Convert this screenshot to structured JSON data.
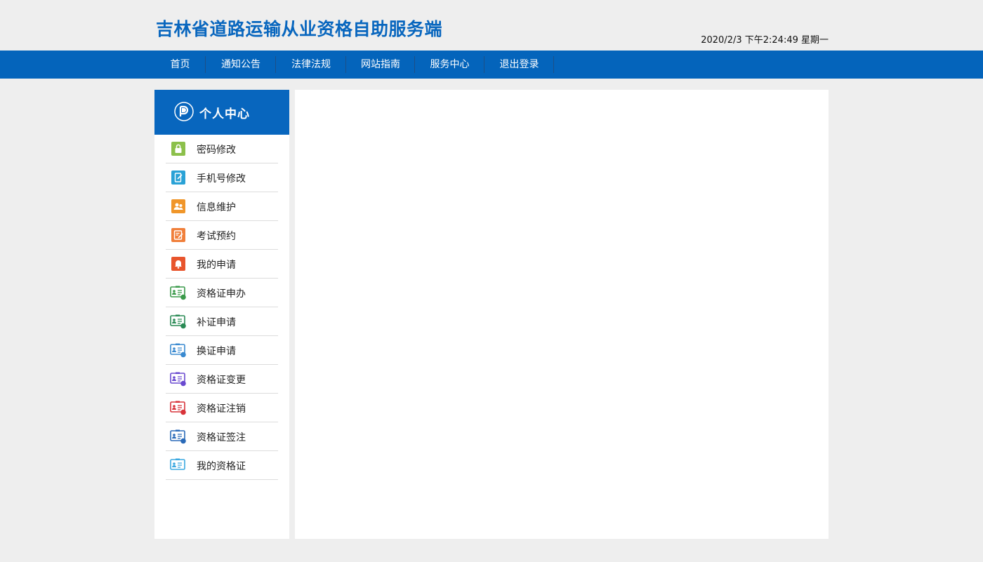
{
  "header": {
    "title": "吉林省道路运输从业资格自助服务端",
    "datetime": "2020/2/3 下午2:24:49 星期一"
  },
  "colors": {
    "brand_blue": "#0464bb",
    "sidebar_header": "#0866be",
    "page_bg": "#eeeeee"
  },
  "nav": {
    "items": [
      {
        "label": "首页"
      },
      {
        "label": "通知公告"
      },
      {
        "label": "法律法规"
      },
      {
        "label": "网站指南"
      },
      {
        "label": "服务中心"
      },
      {
        "label": "退出登录"
      }
    ]
  },
  "sidebar": {
    "title": "个人中心",
    "logo_icon": "p-circle-logo-icon",
    "items": [
      {
        "label": "密码修改",
        "icon": "lock-icon",
        "color": "#8cc04b"
      },
      {
        "label": "手机号修改",
        "icon": "phone-edit-icon",
        "color": "#2aa2d6"
      },
      {
        "label": "信息维护",
        "icon": "user-info-icon",
        "color": "#f0962a"
      },
      {
        "label": "考试预约",
        "icon": "exam-note-icon",
        "color": "#f07f3a"
      },
      {
        "label": "我的申请",
        "icon": "bell-icon",
        "color": "#e8552d"
      },
      {
        "label": "资格证申办",
        "icon": "id-card-apply-icon",
        "color": "#3a9a4a"
      },
      {
        "label": "补证申请",
        "icon": "id-card-reissue-icon",
        "color": "#2a8a55"
      },
      {
        "label": "换证申请",
        "icon": "id-card-renew-icon",
        "color": "#3a8ad0"
      },
      {
        "label": "资格证变更",
        "icon": "id-card-change-icon",
        "color": "#6a4ad0"
      },
      {
        "label": "资格证注销",
        "icon": "id-card-cancel-icon",
        "color": "#d8333a"
      },
      {
        "label": "资格证签注",
        "icon": "id-card-endorse-icon",
        "color": "#2a6ab8"
      },
      {
        "label": "我的资格证",
        "icon": "id-card-mine-icon",
        "color": "#3aa8e0"
      }
    ]
  }
}
